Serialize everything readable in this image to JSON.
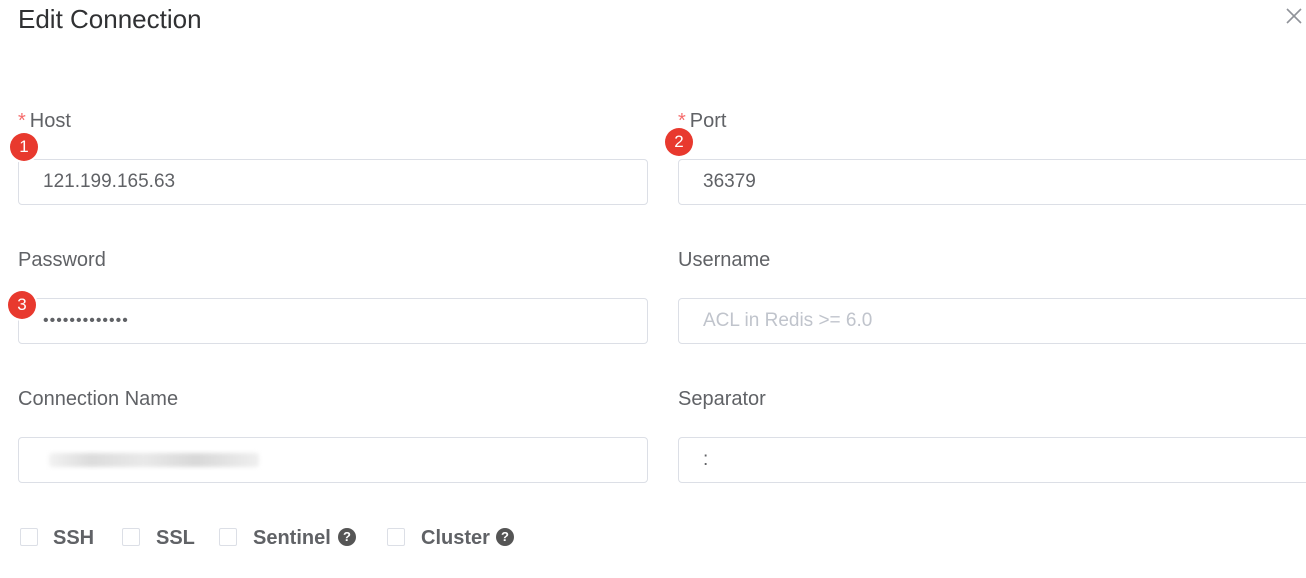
{
  "dialog": {
    "title": "Edit Connection"
  },
  "fields": {
    "host": {
      "label": "Host",
      "required_mark": "*",
      "value": "121.199.165.63"
    },
    "port": {
      "label": "Port",
      "required_mark": "*",
      "value": "36379"
    },
    "password": {
      "label": "Password",
      "value": "•••••••••••••"
    },
    "username": {
      "label": "Username",
      "value": "",
      "placeholder": "ACL in Redis >= 6.0"
    },
    "connection_name": {
      "label": "Connection Name",
      "value": ""
    },
    "separator": {
      "label": "Separator",
      "value": ":"
    }
  },
  "annotations": [
    "1",
    "2",
    "3"
  ],
  "options": {
    "ssh": {
      "label": "SSH",
      "checked": false
    },
    "ssl": {
      "label": "SSL",
      "checked": false
    },
    "sentinel": {
      "label": "Sentinel",
      "checked": false,
      "help_icon": "question-circle-icon",
      "help_glyph": "?"
    },
    "cluster": {
      "label": "Cluster",
      "checked": false,
      "help_icon": "question-circle-icon",
      "help_glyph": "?"
    }
  },
  "colors": {
    "required": "#f56c6c",
    "badge": "#e8392e",
    "border": "#dcdfe6",
    "placeholder": "#c0c4cc"
  }
}
